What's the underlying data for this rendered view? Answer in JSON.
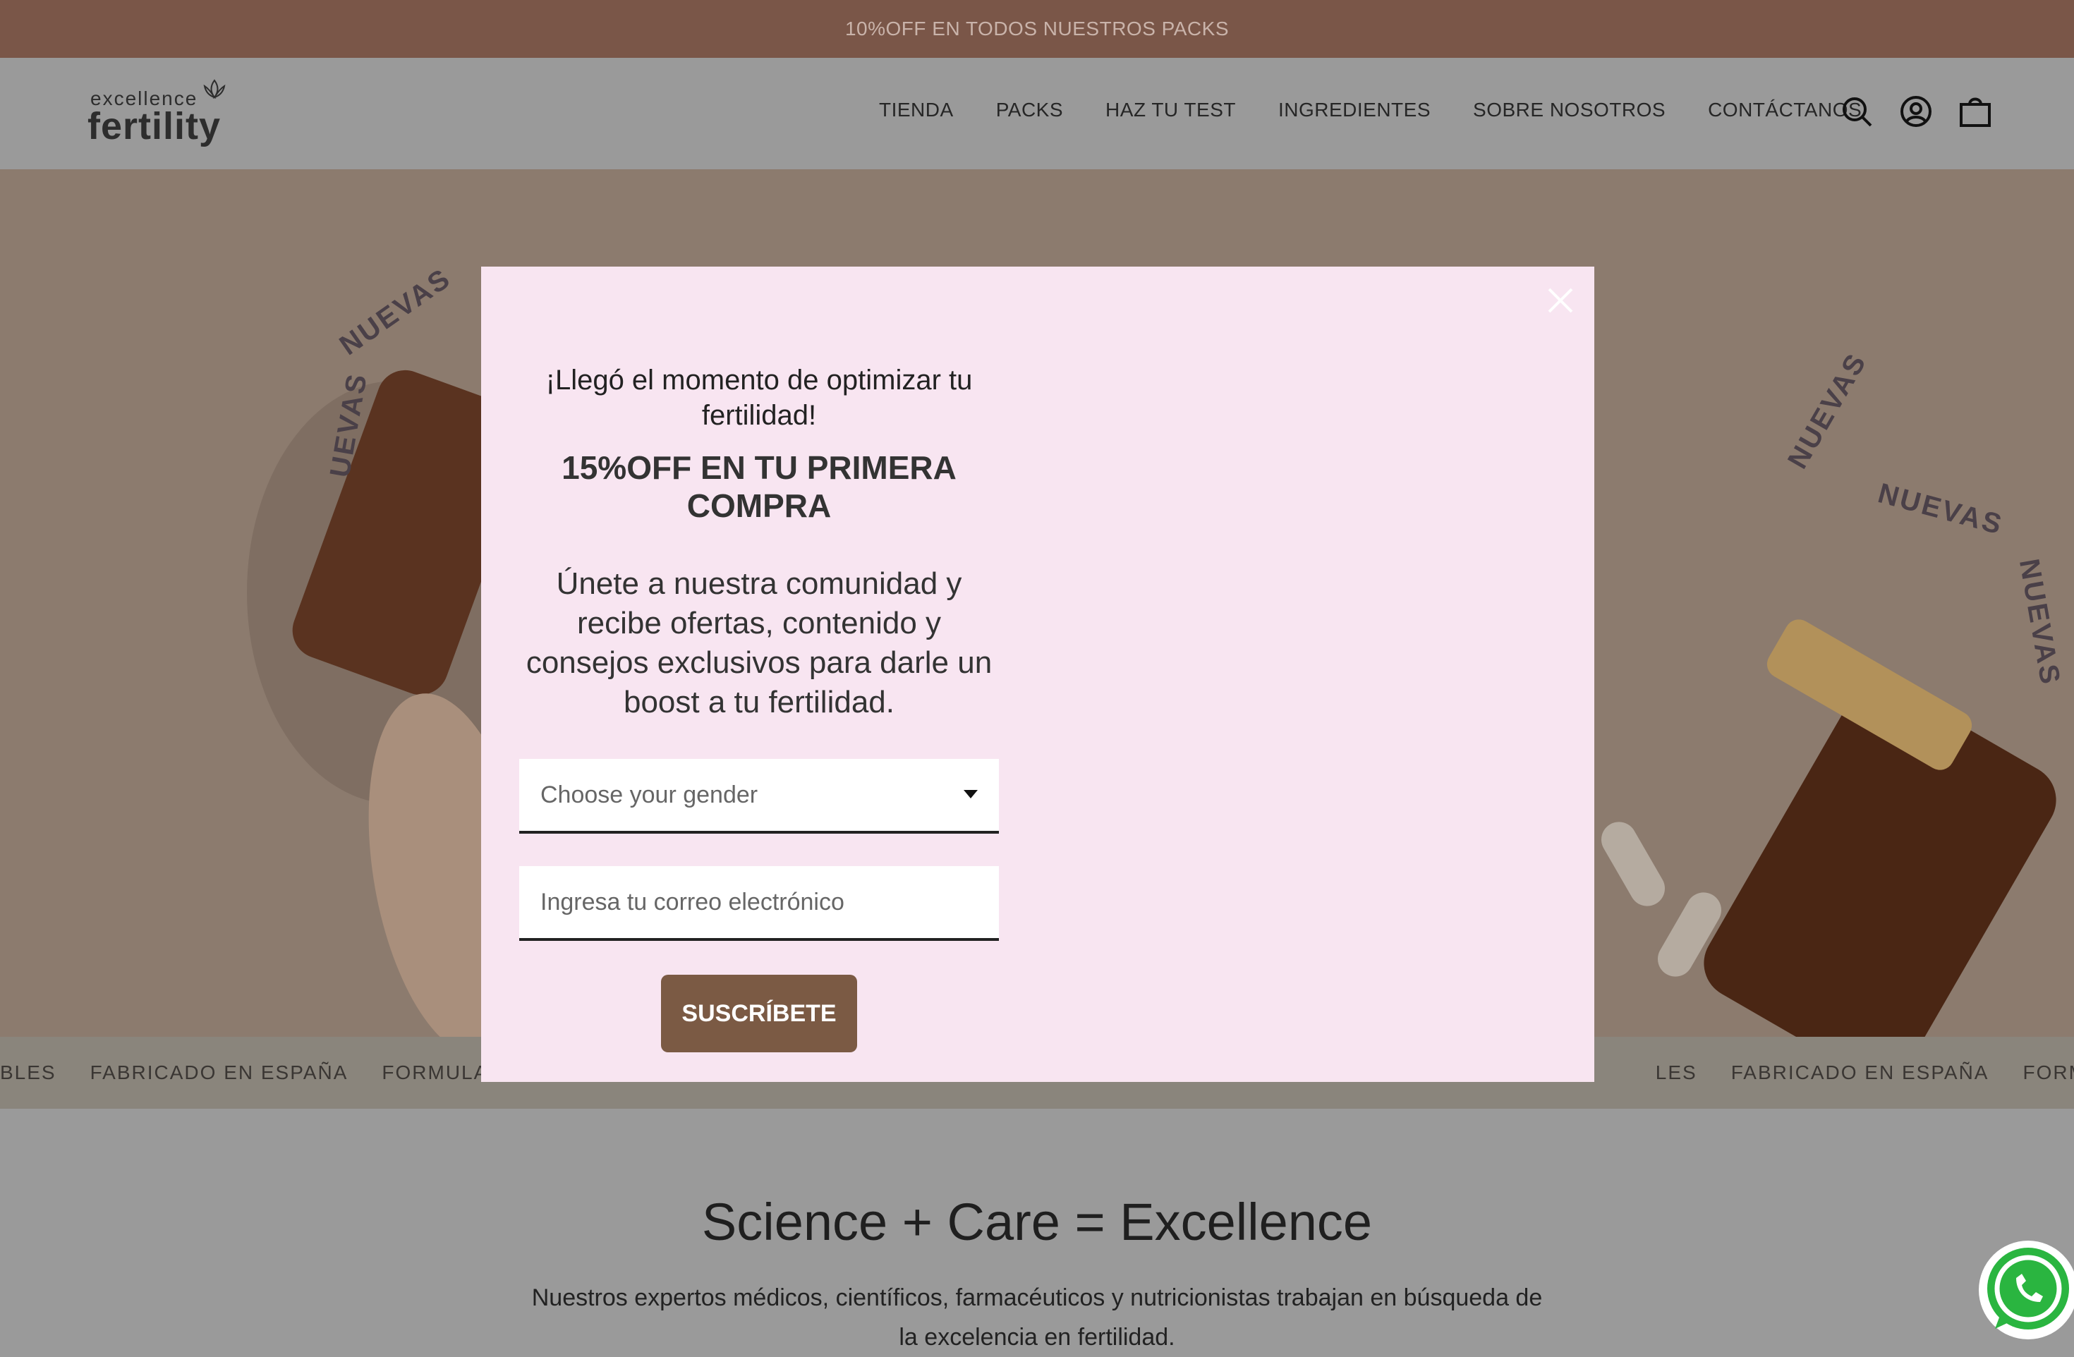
{
  "announcement": {
    "text": "10%OFF EN TODOS NUESTROS PACKS"
  },
  "header": {
    "logo_small": "excellence",
    "logo_big": "fertility",
    "nav": [
      "TIENDA",
      "PACKS",
      "HAZ TU TEST",
      "INGREDIENTES",
      "SOBRE NOSOTROS",
      "CONTÁCTANOS"
    ],
    "icons": [
      "search-icon",
      "account-icon",
      "bag-icon"
    ]
  },
  "hero": {
    "arc_left_1": "NUEVAS",
    "arc_left_2": "UEVAS",
    "arc_right_1": "NUEVAS",
    "arc_right_2": "NUEVAS",
    "arc_right_3": "NUEVAS"
  },
  "ticker": {
    "items": [
      "BLES",
      "FABRICADO EN ESPAÑA",
      "FORMULADO P",
      "LES",
      "FABRICADO EN ESPAÑA",
      "FORMULADO PO"
    ]
  },
  "modal": {
    "heading": "¡Llegó el momento de optimizar tu fertilidad!",
    "offer": "15%OFF EN TU PRIMERA COMPRA",
    "description": "Únete a nuestra comunidad  y recibe ofertas, contenido y consejos exclusivos para darle un boost a tu fertilidad.",
    "gender_placeholder": "Choose your gender",
    "email_placeholder": "Ingresa tu correo electrónico",
    "submit_label": "SUSCRÍBETE"
  },
  "science": {
    "title": "Science + Care = Excellence",
    "text": "Nuestros expertos médicos, científicos, farmacéuticos y nutricionistas trabajan en búsqueda de la excelencia en fertilidad."
  },
  "colors": {
    "announce_bg": "#7a5648",
    "modal_bg": "#f8e5f1",
    "button_bg": "#7b5a44"
  }
}
